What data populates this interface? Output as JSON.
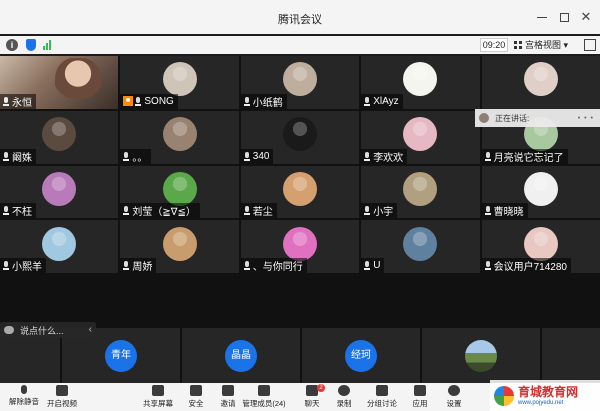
{
  "window": {
    "title": "腾讯会议"
  },
  "toolbar": {
    "time": "09:20",
    "view_label": "宫格视图"
  },
  "speaking": {
    "label": "正在讲话:"
  },
  "participants": [
    {
      "name": "永恒",
      "avatar": "camera",
      "mic": "active"
    },
    {
      "name": "SONG",
      "avatar": "#cfc4b8",
      "mic": "muted",
      "badge": true
    },
    {
      "name": "小纸鹤",
      "avatar": "#bfae9e",
      "mic": "muted"
    },
    {
      "name": "XlAyz",
      "avatar": "#f5f5ef",
      "mic": "muted"
    },
    {
      "name": "",
      "avatar": "#e0cfc8",
      "mic": "none"
    },
    {
      "name": "阚姝",
      "avatar": "#5a4a40",
      "mic": "muted"
    },
    {
      "name": "。。",
      "avatar": "#9a8270",
      "mic": "muted"
    },
    {
      "name": "340",
      "avatar": "#1a1a1a",
      "mic": "muted"
    },
    {
      "name": "李欢欢",
      "avatar": "#e6b8c4",
      "mic": "muted"
    },
    {
      "name": "月亮说它忘记了",
      "avatar": "#a8c8a0",
      "mic": "muted"
    },
    {
      "name": "不枉",
      "avatar": "#b87ab8",
      "mic": "muted"
    },
    {
      "name": "刘莹（≧∇≦）",
      "avatar": "#5aa84a",
      "mic": "muted"
    },
    {
      "name": "若尘",
      "avatar": "#d4a070",
      "mic": "muted"
    },
    {
      "name": "小宇",
      "avatar": "#b0a080",
      "mic": "muted"
    },
    {
      "name": "曹晓晓",
      "avatar": "#f0f0f0",
      "mic": "muted"
    },
    {
      "name": "小熙羊",
      "avatar": "#a0c8e0",
      "mic": "muted"
    },
    {
      "name": "周娇",
      "avatar": "#c89c6c",
      "mic": "muted"
    },
    {
      "name": "、与你同行",
      "avatar": "#e070c0",
      "mic": "muted"
    },
    {
      "name": "U",
      "avatar": "#6080a0",
      "mic": "muted"
    },
    {
      "name": "会议用户714280",
      "avatar": "#e8c8c0",
      "mic": "muted"
    }
  ],
  "chat": {
    "placeholder": "说点什么..."
  },
  "bottom_tiles": [
    {
      "label": "青年",
      "kind": "pill"
    },
    {
      "label": "晶晶",
      "kind": "pill"
    },
    {
      "label": "经珂",
      "kind": "pill"
    },
    {
      "label": "",
      "kind": "image"
    }
  ],
  "controls": [
    {
      "label": "解除静音",
      "icon": "mic-icon"
    },
    {
      "label": "开启视频",
      "icon": "video-icon"
    },
    {
      "label": "共享屏幕",
      "icon": "screen-share-icon"
    },
    {
      "label": "安全",
      "icon": "shield-icon"
    },
    {
      "label": "邀请",
      "icon": "add-user-icon"
    },
    {
      "label": "管理成员(24)",
      "icon": "members-icon"
    },
    {
      "label": "聊天",
      "icon": "chat-icon",
      "badge": "2"
    },
    {
      "label": "录制",
      "icon": "record-icon"
    },
    {
      "label": "分组讨论",
      "icon": "breakout-icon"
    },
    {
      "label": "应用",
      "icon": "apps-icon"
    },
    {
      "label": "设置",
      "icon": "gear-icon"
    }
  ],
  "watermark": {
    "title": "育城教育网",
    "url": "www.pojyedu.net"
  }
}
